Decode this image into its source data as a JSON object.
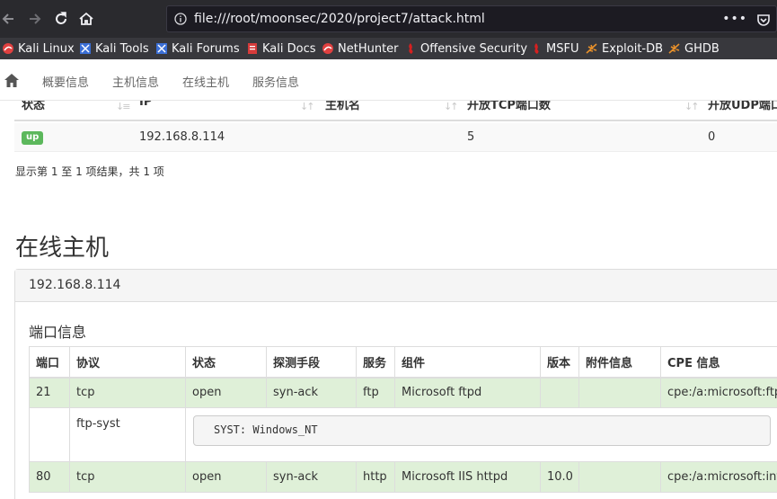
{
  "browser": {
    "url": "file:///root/moonsec/2020/project7/attack.html",
    "menu_dots": "•••",
    "bookmarks": [
      {
        "label": "Kali Linux",
        "icon": "kali-icon"
      },
      {
        "label": "Kali Tools",
        "icon": "kali-tools-icon"
      },
      {
        "label": "Kali Forums",
        "icon": "kali-forums-icon"
      },
      {
        "label": "Kali Docs",
        "icon": "kali-docs-icon"
      },
      {
        "label": "NetHunter",
        "icon": "nethunter-icon"
      },
      {
        "label": "Offensive Security",
        "icon": "offsec-icon"
      },
      {
        "label": "MSFU",
        "icon": "msfu-icon"
      },
      {
        "label": "Exploit-DB",
        "icon": "exploit-db-icon"
      },
      {
        "label": "GHDB",
        "icon": "ghdb-icon"
      }
    ]
  },
  "navbar": {
    "items": [
      "概要信息",
      "主机信息",
      "在线主机",
      "服务信息"
    ]
  },
  "hosts_table": {
    "headers": [
      "状态",
      "IP",
      "主机名",
      "开放TCP端口数",
      "开放UDP端口"
    ],
    "row": {
      "status": "up",
      "ip": "192.168.8.114",
      "hostname": "",
      "tcp_ports": "5",
      "udp_ports": "0"
    },
    "result_info": "显示第 1 至 1 项结果，共 1 项"
  },
  "online_hosts": {
    "title": "在线主机",
    "host": "192.168.8.114",
    "ports_title": "端口信息",
    "headers": [
      "端口",
      "协议",
      "状态",
      "探测手段",
      "服务",
      "组件",
      "版本",
      "附件信息",
      "CPE 信息"
    ],
    "rows": [
      {
        "port": "21",
        "protocol": "tcp",
        "state": "open",
        "method": "syn-ack",
        "service": "ftp",
        "product": "Microsoft ftpd",
        "version": "",
        "extra": "",
        "cpe": "cpe:/a:microsoft:ftp_s"
      },
      {
        "port": "80",
        "protocol": "tcp",
        "state": "open",
        "method": "syn-ack",
        "service": "http",
        "product": "Microsoft IIS httpd",
        "version": "10.0",
        "extra": "",
        "cpe": "cpe:/a:microsoft:intern"
      }
    ],
    "script": {
      "name": "ftp-syst",
      "output": "SYST: Windows_NT"
    }
  },
  "colors": {
    "success_row": "#dff0d8",
    "badge_up": "#5cb85c",
    "browser_bg": "#2a2a2e"
  }
}
